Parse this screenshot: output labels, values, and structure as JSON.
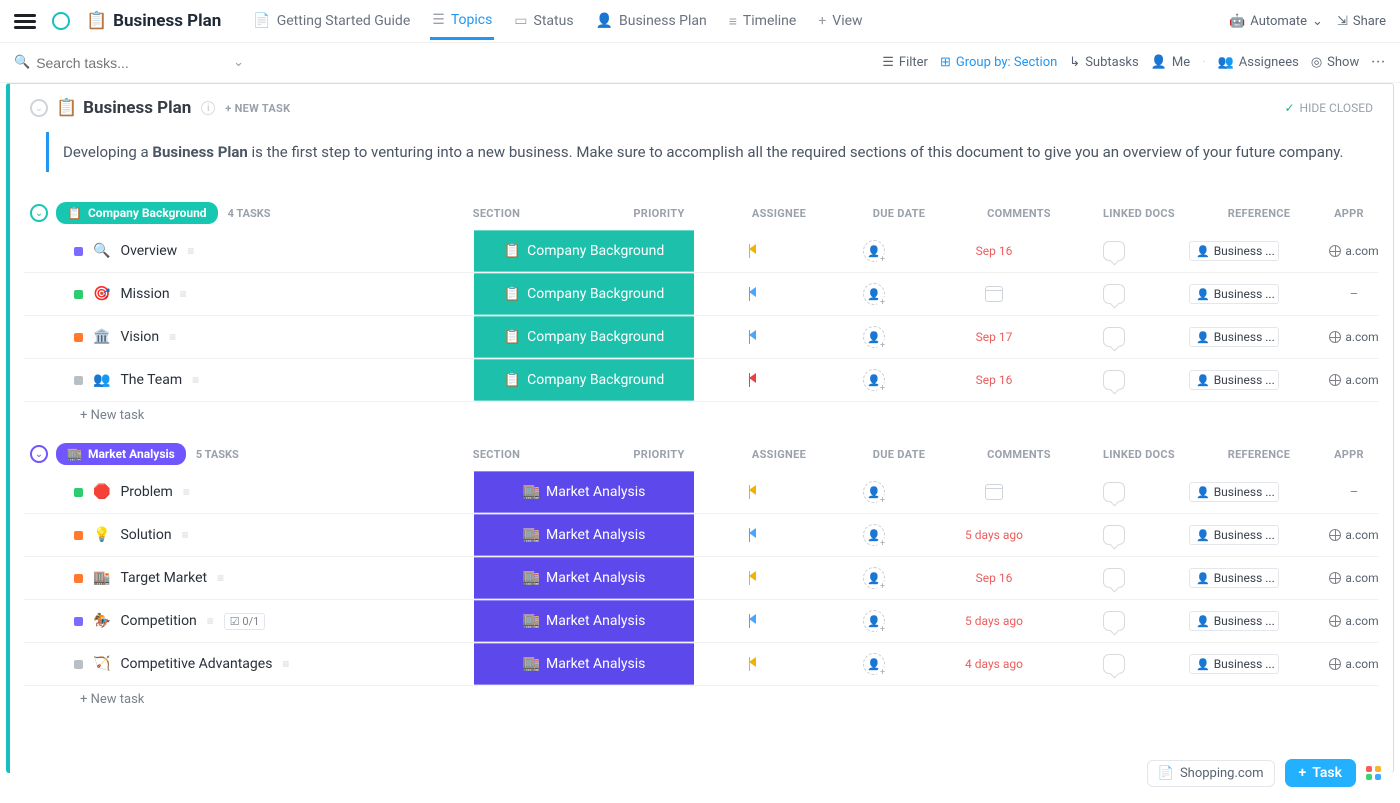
{
  "header": {
    "title": "Business Plan",
    "title_emoji": "📋",
    "tabs": [
      {
        "id": "getting-started",
        "label": "Getting Started Guide",
        "emoji": "📄",
        "active": false
      },
      {
        "id": "topics",
        "label": "Topics",
        "emoji": "☰",
        "active": true
      },
      {
        "id": "status",
        "label": "Status",
        "emoji": "▭",
        "active": false
      },
      {
        "id": "business-plan",
        "label": "Business Plan",
        "emoji": "👤",
        "active": false
      },
      {
        "id": "timeline",
        "label": "Timeline",
        "emoji": "≡",
        "active": false
      },
      {
        "id": "add-view",
        "label": "View",
        "emoji": "+",
        "active": false
      }
    ],
    "automate_label": "Automate",
    "share_label": "Share"
  },
  "toolbar": {
    "search_placeholder": "Search tasks...",
    "filter": "Filter",
    "group_by": "Group by: Section",
    "subtasks": "Subtasks",
    "me": "Me",
    "assignees": "Assignees",
    "show": "Show"
  },
  "list_header": {
    "title": "Business Plan",
    "emoji": "📋",
    "new_task": "+ NEW TASK",
    "hide_closed": "HIDE CLOSED"
  },
  "description": {
    "pre": "Developing a ",
    "bold": "Business Plan",
    "post": " is the first step to venturing into a new business. Make sure to accomplish all the required sections of this document to give you an overview of your future company."
  },
  "columns": [
    "SECTION",
    "PRIORITY",
    "ASSIGNEE",
    "DUE DATE",
    "COMMENTS",
    "LINKED DOCS",
    "REFERENCE",
    "APPR"
  ],
  "groups": [
    {
      "id": "company-background",
      "label": "Company Background",
      "emoji": "📋",
      "color": "#18c7b1",
      "task_count": "4 TASKS",
      "section_color": "#1cc0ab",
      "rows": [
        {
          "status": "#7d6aff",
          "emoji": "🔍",
          "name": "Overview",
          "section": "Company Background",
          "sec_emoji": "📋",
          "priority": "yellow",
          "due": "Sep 16",
          "ref": "a.com",
          "appr": "#e6e6e6"
        },
        {
          "status": "#2dcc70",
          "emoji": "🎯",
          "name": "Mission",
          "section": "Company Background",
          "sec_emoji": "📋",
          "priority": "blue",
          "due": "",
          "ref": "–",
          "appr": "#23b0ff",
          "cal": true
        },
        {
          "status": "#ff7a2d",
          "emoji": "🏛️",
          "name": "Vision",
          "section": "Company Background",
          "sec_emoji": "📋",
          "priority": "blue",
          "due": "Sep 17",
          "ref": "a.com",
          "appr": "#e6e6e6"
        },
        {
          "status": "#b9bfc7",
          "emoji": "👥",
          "name": "The Team",
          "section": "Company Background",
          "sec_emoji": "📋",
          "priority": "red",
          "due": "Sep 16",
          "ref": "a.com",
          "appr": "#e6e6e6"
        }
      ],
      "new_task": "+ New task"
    },
    {
      "id": "market-analysis",
      "label": "Market Analysis",
      "emoji": "🏬",
      "color": "#6f56ff",
      "task_count": "5 TASKS",
      "section_color": "#5d48ec",
      "rows": [
        {
          "status": "#2dcc70",
          "emoji": "🛑",
          "name": "Problem",
          "section": "Market Analysis",
          "sec_emoji": "🏬",
          "priority": "yellow",
          "due": "",
          "ref": "–",
          "appr": "#23b0ff",
          "cal": true
        },
        {
          "status": "#ff7a2d",
          "emoji": "💡",
          "name": "Solution",
          "section": "Market Analysis",
          "sec_emoji": "🏬",
          "priority": "blue",
          "due": "5 days ago",
          "ref": "a.com",
          "appr": "#e6e6e6"
        },
        {
          "status": "#ff7a2d",
          "emoji": "🏬",
          "name": "Target Market",
          "section": "Market Analysis",
          "sec_emoji": "🏬",
          "priority": "yellow",
          "due": "Sep 16",
          "ref": "a.com",
          "appr": "#e6e6e6"
        },
        {
          "status": "#7d6aff",
          "emoji": "🏇",
          "name": "Competition",
          "section": "Market Analysis",
          "sec_emoji": "🏬",
          "priority": "blue",
          "due": "5 days ago",
          "ref": "a.com",
          "appr": "#e6e6e6",
          "subtasks": "0/1"
        },
        {
          "status": "#b9bfc7",
          "emoji": "🏹",
          "name": "Competitive Advantages",
          "section": "Market Analysis",
          "sec_emoji": "🏬",
          "priority": "yellow",
          "due": "4 days ago",
          "ref": "a.com",
          "appr": "#e6e6e6"
        }
      ],
      "new_task": "+ New task"
    }
  ],
  "linked_doc_label": "Business ...",
  "floatbar": {
    "shopping": "Shopping.com",
    "task_btn": "Task"
  }
}
